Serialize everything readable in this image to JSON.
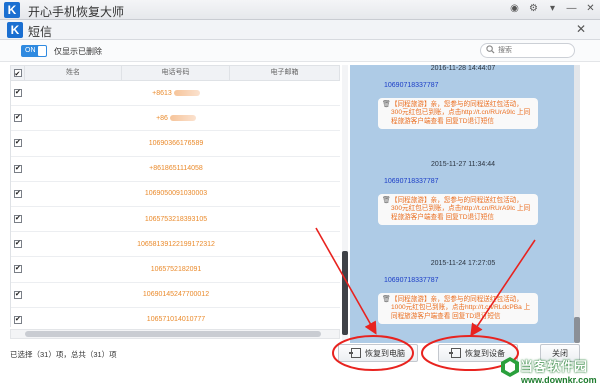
{
  "app": {
    "title": "开心手机恢复大师",
    "logo_letter": "K"
  },
  "dialog": {
    "title": "短信",
    "logo_letter": "K",
    "toggle_label": "ON",
    "toggle_text": "仅显示已删除",
    "search_placeholder": "搜索"
  },
  "table": {
    "headers": [
      "姓名",
      "电话号码",
      "电子邮箱"
    ],
    "rows": [
      {
        "phone": "+8613",
        "masked": true
      },
      {
        "phone": "+86",
        "masked": true
      },
      {
        "phone": "10690366176589",
        "masked": false
      },
      {
        "phone": "+8618651114058",
        "masked": false
      },
      {
        "phone": "1069050091030003",
        "masked": false
      },
      {
        "phone": "1065753218393105",
        "masked": false
      },
      {
        "phone": "1065813912219917231​2",
        "masked": false
      },
      {
        "phone": "1065752182091",
        "masked": false
      },
      {
        "phone": "1069014524770001​2",
        "masked": false
      },
      {
        "phone": "106571014010777",
        "masked": false
      }
    ]
  },
  "messages": [
    {
      "date": "2016-11-28 14:44:07",
      "sender": "10690718337787",
      "text": "【同程旅游】亲，您参与的同程送红包活动，300元红包已到账，点击http://t.cn/RUrA9Ic 上同程旅游客户端查看 回复TD退订短信"
    },
    {
      "date": "2015-11-27 11:34:44",
      "sender": "10690718337787",
      "text": "【同程旅游】亲，您参与的同程送红包活动，300元红包已到账，点击http://t.cn/RUrA9Ic 上同程旅游客户端查看 回复TD退订短信"
    },
    {
      "date": "2015-11-24 17:27:05",
      "sender": "10690718337787",
      "text": "【同程旅游】亲，您参与的同程送红包活动，1000元红包已到账，点击http://t.cn/RLdcPBa 上同程旅游客户端查看 回复TD退订短信"
    }
  ],
  "status": {
    "text": "已选择（31）项，总共（31）项"
  },
  "buttons": {
    "restore_pc": "恢复到电脑",
    "restore_device": "恢复到设备",
    "close": "关闭"
  },
  "watermark": {
    "name": "当客软件园",
    "url": "www.downkr.com"
  },
  "colors": {
    "accent": "#2f8ae0",
    "phone_text": "#ea8a2b",
    "message_panel_bg": "#aecbe6",
    "bubble_text": "#ea6d1f",
    "sender_text": "#1a3cc6",
    "annotation_red": "#e8231f",
    "watermark_green": "#1e7c2e"
  }
}
